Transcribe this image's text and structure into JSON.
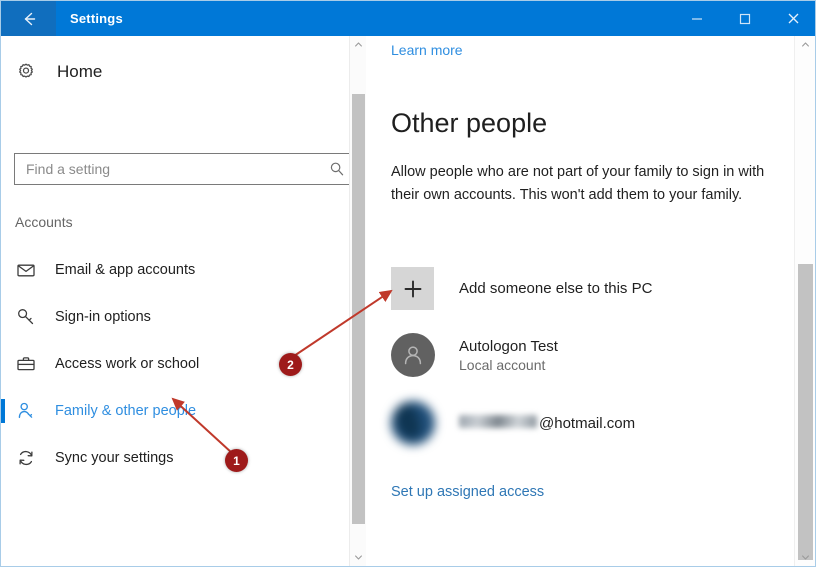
{
  "titlebar": {
    "back_icon": "back-arrow-icon",
    "title": "Settings",
    "minimize_icon": "minimize-icon",
    "maximize_icon": "maximize-icon",
    "close_icon": "close-icon",
    "bg_color": "#0078d7"
  },
  "sidebar": {
    "home_label": "Home",
    "home_icon": "gear-icon",
    "search": {
      "placeholder": "Find a setting",
      "value": "",
      "icon": "search-icon"
    },
    "section_header": "Accounts",
    "items": [
      {
        "label": "Email & app accounts",
        "icon": "envelope-icon",
        "selected": false
      },
      {
        "label": "Sign-in options",
        "icon": "key-icon",
        "selected": false
      },
      {
        "label": "Access work or school",
        "icon": "briefcase-icon",
        "selected": false
      },
      {
        "label": "Family & other people",
        "icon": "person-key-icon",
        "selected": true
      },
      {
        "label": "Sync your settings",
        "icon": "sync-icon",
        "selected": false
      }
    ],
    "selected_color": "#2f8ee0",
    "accent_color": "#0078d7"
  },
  "main": {
    "learn_more": "Learn more",
    "title": "Other people",
    "description": "Allow people who are not part of your family to sign in with their own accounts. This won't add them to your family.",
    "add_person": {
      "label": "Add someone else to this PC",
      "icon": "plus-icon"
    },
    "accounts": [
      {
        "name": "Autologon Test",
        "subtitle": "Local account",
        "avatar": "person-avatar-icon",
        "blurred": false
      },
      {
        "name": "@hotmail.com",
        "subtitle": "",
        "avatar": "photo-avatar-icon",
        "blurred": true
      }
    ],
    "assigned_access_link": "Set up assigned access",
    "link_color": "#2f8ee0"
  },
  "scrollbars": {
    "left": {
      "up_icon": "chevron-up-icon",
      "down_icon": "chevron-down-icon"
    },
    "right": {
      "up_icon": "chevron-up-icon",
      "down_icon": "chevron-down-icon"
    }
  },
  "annotations": {
    "marker_color": "#9e1a1a",
    "markers": [
      {
        "label": "1"
      },
      {
        "label": "2"
      }
    ]
  }
}
